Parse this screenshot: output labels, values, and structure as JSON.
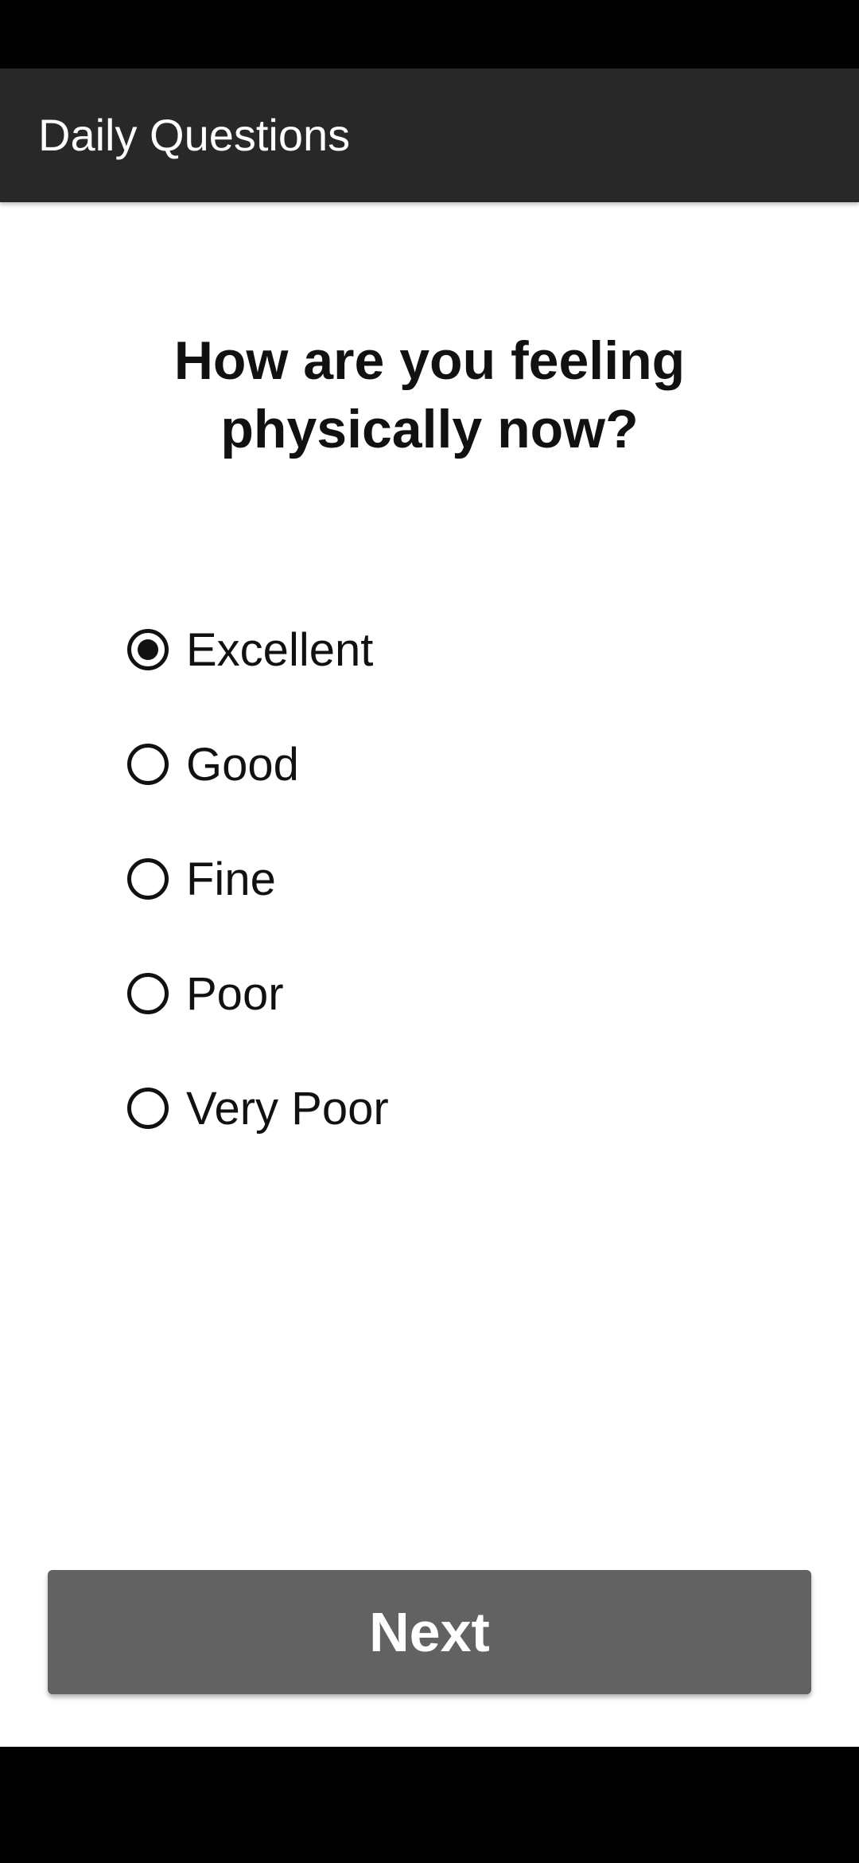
{
  "app_bar": {
    "title": "Daily Questions"
  },
  "question": {
    "text": "How are you feeling physically now?"
  },
  "options": [
    {
      "label": "Excellent",
      "checked": true
    },
    {
      "label": "Good",
      "checked": false
    },
    {
      "label": "Fine",
      "checked": false
    },
    {
      "label": "Poor",
      "checked": false
    },
    {
      "label": "Very Poor",
      "checked": false
    }
  ],
  "actions": {
    "next_label": "Next"
  },
  "colors": {
    "app_bar": "#282828",
    "button": "#626262",
    "background": "#ffffff"
  }
}
